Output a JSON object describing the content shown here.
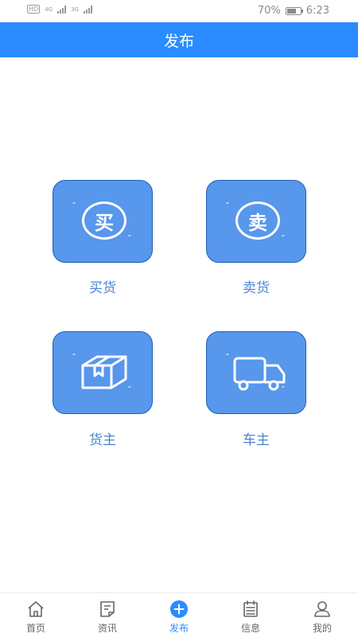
{
  "status_bar": {
    "hd_label": "HD",
    "net1": "4G",
    "net2": "3G",
    "battery": "70%",
    "battery_level": 0.7,
    "time": "6:23"
  },
  "header": {
    "title": "发布"
  },
  "tiles": [
    {
      "label": "买货",
      "glyph": "买",
      "icon": "buy-icon"
    },
    {
      "label": "卖货",
      "glyph": "卖",
      "icon": "sell-icon"
    },
    {
      "label": "货主",
      "icon": "box-icon"
    },
    {
      "label": "车主",
      "icon": "truck-icon"
    }
  ],
  "tabbar": {
    "items": [
      {
        "label": "首页",
        "icon": "home-icon"
      },
      {
        "label": "资讯",
        "icon": "news-icon"
      },
      {
        "label": "发布",
        "icon": "plus-icon",
        "active": true
      },
      {
        "label": "信息",
        "icon": "calendar-icon"
      },
      {
        "label": "我的",
        "icon": "person-icon"
      }
    ]
  },
  "colors": {
    "accent": "#2a8cff",
    "tile_fill": "#5797ec",
    "tile_border": "#1f5fb6",
    "tile_label": "#4a84cf"
  }
}
